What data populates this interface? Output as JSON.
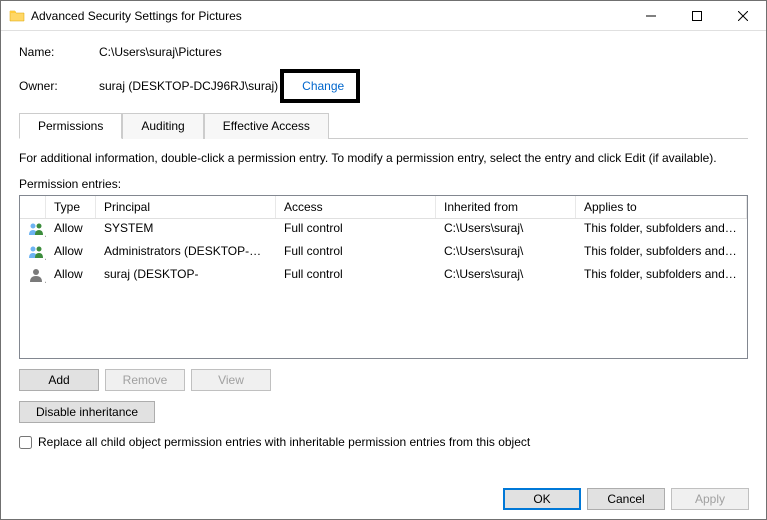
{
  "window": {
    "title": "Advanced Security Settings for Pictures"
  },
  "info": {
    "name_label": "Name:",
    "name_value": "C:\\Users\\suraj\\Pictures",
    "owner_label": "Owner:",
    "owner_value": "suraj (DESKTOP-DCJ96RJ\\suraj)",
    "change_link": "Change"
  },
  "tabs": {
    "permissions": "Permissions",
    "auditing": "Auditing",
    "effective": "Effective Access"
  },
  "instruction": "For additional information, double-click a permission entry. To modify a permission entry, select the entry and click Edit (if available).",
  "section_label": "Permission entries:",
  "columns": {
    "type": "Type",
    "principal": "Principal",
    "access": "Access",
    "inherited": "Inherited from",
    "applies": "Applies to"
  },
  "rows": [
    {
      "type": "Allow",
      "principal": "SYSTEM",
      "access": "Full control",
      "inherited": "C:\\Users\\suraj\\",
      "applies": "This folder, subfolders and files"
    },
    {
      "type": "Allow",
      "principal": "Administrators (DESKTOP-DC...",
      "access": "Full control",
      "inherited": "C:\\Users\\suraj\\",
      "applies": "This folder, subfolders and files"
    },
    {
      "type": "Allow",
      "principal": "suraj (DESKTOP-",
      "access": "Full control",
      "inherited": "C:\\Users\\suraj\\",
      "applies": "This folder, subfolders and files"
    }
  ],
  "buttons": {
    "add": "Add",
    "remove": "Remove",
    "view": "View",
    "disable_inheritance": "Disable inheritance",
    "ok": "OK",
    "cancel": "Cancel",
    "apply": "Apply"
  },
  "checkbox_label": "Replace all child object permission entries with inheritable permission entries from this object"
}
